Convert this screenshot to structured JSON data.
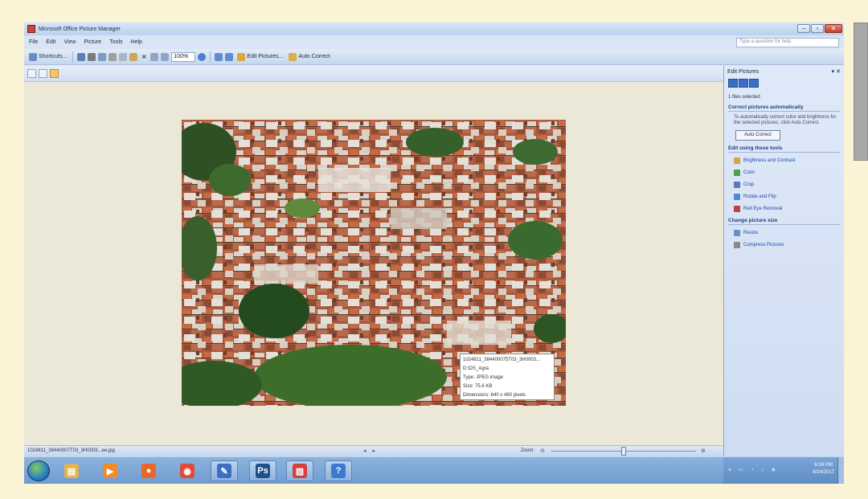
{
  "window": {
    "title": "Microsoft Office Picture Manager"
  },
  "menu": [
    "File",
    "Edit",
    "View",
    "Picture",
    "Tools",
    "Help"
  ],
  "help_box": {
    "placeholder": "Type a question for help"
  },
  "toolbar": {
    "shortcuts_label": "Shortcuts...",
    "zoom_value": "100%",
    "edit_pictures_label": "Edit Pictures...",
    "auto_correct_label": "Auto Correct"
  },
  "photo_info": {
    "filename": "1024811_384400075T03_3H0003...",
    "location": "D:\\DS_Agra",
    "type": "Type: JPEG image",
    "size": "Size: 75.6 KB",
    "dimensions": "Dimensions: 640 x 480 pixels"
  },
  "status": {
    "filename": "1024811_38440007T03_3H0003...ee.jpg",
    "zoom_label": "Zoom:",
    "zoom_level": 0.5
  },
  "taskpane": {
    "title": "Edit Pictures",
    "selection": "1 files selected",
    "section_auto": "Correct pictures automatically",
    "auto_desc": "To automatically correct color and brightness for the selected pictures, click Auto Correct.",
    "auto_button": "Auto Correct",
    "section_tools": "Edit using these tools",
    "tools": [
      {
        "label": "Brightness and Contrast",
        "icon": "brightness-icon",
        "color": "#d3a24a"
      },
      {
        "label": "Color",
        "icon": "color-icon",
        "color": "#4aa04a"
      },
      {
        "label": "Crop",
        "icon": "crop-icon",
        "color": "#5b7bb8"
      },
      {
        "label": "Rotate and Flip",
        "icon": "rotate-icon",
        "color": "#4d8bd6"
      },
      {
        "label": "Red Eye Removal",
        "icon": "red-eye-icon",
        "color": "#c04040"
      }
    ],
    "section_size": "Change picture size",
    "size_tools": [
      {
        "label": "Resize",
        "icon": "resize-icon",
        "color": "#6c8fc4"
      },
      {
        "label": "Compress Pictures",
        "icon": "compress-icon",
        "color": "#8a8a8a"
      }
    ]
  },
  "taskbar": {
    "time": "6:24 PM",
    "date": "8/24/2017",
    "apps": [
      {
        "name": "explorer",
        "glyph": "▤",
        "color": "#e2b652"
      },
      {
        "name": "media-player",
        "glyph": "▶",
        "color": "#f08a2a"
      },
      {
        "name": "firefox",
        "glyph": "●",
        "color": "#e8662a"
      },
      {
        "name": "chrome",
        "glyph": "◉",
        "color": "#e04a3a"
      },
      {
        "name": "picture-manager",
        "glyph": "✎",
        "color": "#3a6fc4"
      },
      {
        "name": "photoshop",
        "glyph": "Ps",
        "color": "#1f4e8c"
      },
      {
        "name": "pdf-reader",
        "glyph": "▨",
        "color": "#d24040"
      },
      {
        "name": "help",
        "glyph": "?",
        "color": "#3a7ad0"
      }
    ]
  }
}
